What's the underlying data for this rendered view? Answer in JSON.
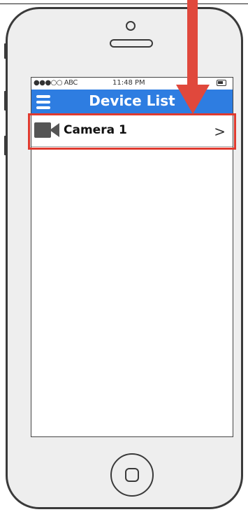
{
  "status_bar": {
    "carrier": "●●●○○ ABC",
    "time": "11:48 PM"
  },
  "nav_bar": {
    "title": "Device List"
  },
  "devices": [
    {
      "name": "Camera 1",
      "icon": "video-camera-icon"
    }
  ],
  "colors": {
    "nav_bg": "#2e7de1",
    "highlight": "#e03a2f",
    "arrow": "#e0483c"
  }
}
